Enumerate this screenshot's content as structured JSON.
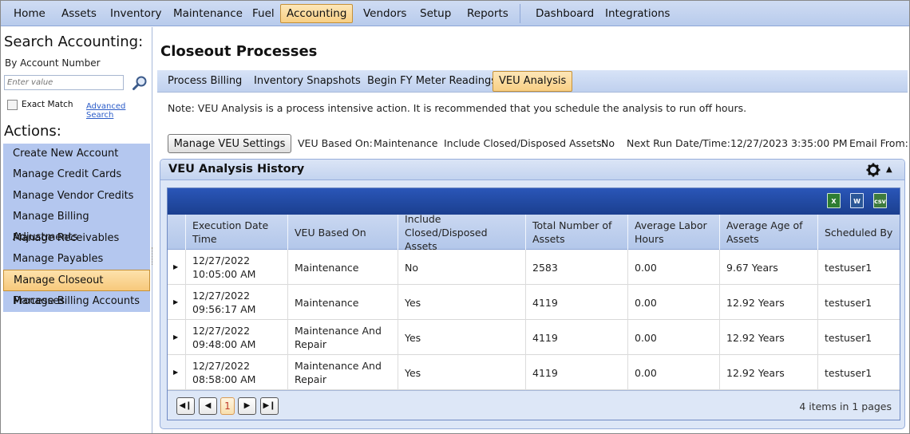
{
  "menu": {
    "items": [
      {
        "label": "Home"
      },
      {
        "label": "Assets"
      },
      {
        "label": "Inventory"
      },
      {
        "label": "Maintenance"
      },
      {
        "label": "Fuel"
      },
      {
        "label": "Accounting"
      },
      {
        "label": "Vendors"
      },
      {
        "label": "Setup"
      },
      {
        "label": "Reports"
      },
      {
        "label": "Dashboard"
      },
      {
        "label": "Integrations"
      }
    ],
    "active": "Accounting"
  },
  "sidebar": {
    "search_title": "Search Accounting:",
    "search_subtitle": "By Account Number",
    "search_placeholder": "Enter value",
    "exact_match_label": "Exact Match",
    "advanced_search_label": "Advanced Search",
    "actions_title": "Actions:",
    "actions": [
      {
        "label": "Create New Account"
      },
      {
        "label": "Manage Credit Cards"
      },
      {
        "label": "Manage Vendor Credits"
      },
      {
        "label": "Manage Billing Adjustments"
      },
      {
        "label": "Manage Receivables"
      },
      {
        "label": "Manage Payables"
      },
      {
        "label": "Manage Closeout Processes"
      },
      {
        "label": "Manage Billing Accounts"
      }
    ],
    "active_action": "Manage Closeout Processes"
  },
  "main": {
    "title": "Closeout Processes",
    "tabs": [
      {
        "label": "Process Billing"
      },
      {
        "label": "Inventory Snapshots"
      },
      {
        "label": "Begin FY Meter Readings"
      },
      {
        "label": "VEU Analysis"
      }
    ],
    "active_tab": "VEU Analysis",
    "note": "Note: VEU Analysis is a process intensive action. It is recommended that you schedule the analysis to run off hours.",
    "manage_button": "Manage VEU Settings",
    "veu_based_on_label": "VEU Based On:",
    "veu_based_on_value": "Maintenance",
    "include_closed_label": "Include Closed/Disposed Assets:",
    "include_closed_value": "No",
    "next_run_label": "Next Run Date/Time:",
    "next_run_value": "12/27/2023 3:35:00 PM",
    "email_from_label": "Email From:"
  },
  "history": {
    "title": "VEU Analysis History",
    "toolbar_icons": [
      "excel-export-icon",
      "word-export-icon",
      "csv-export-icon"
    ],
    "columns": [
      "Execution Date Time",
      "VEU Based On",
      "Include Closed/Disposed Assets",
      "Total Number of Assets",
      "Average Labor Hours",
      "Average Age of Assets",
      "Scheduled By"
    ],
    "rows": [
      [
        "12/27/2022 10:05:00 AM",
        "Maintenance",
        "No",
        "2583",
        "0.00",
        "9.67 Years",
        "testuser1"
      ],
      [
        "12/27/2022 09:56:17 AM",
        "Maintenance",
        "Yes",
        "4119",
        "0.00",
        "12.92 Years",
        "testuser1"
      ],
      [
        "12/27/2022 09:48:00 AM",
        "Maintenance And Repair",
        "Yes",
        "4119",
        "0.00",
        "12.92 Years",
        "testuser1"
      ],
      [
        "12/27/2022 08:58:00 AM",
        "Maintenance And Repair",
        "Yes",
        "4119",
        "0.00",
        "12.92 Years",
        "testuser1"
      ]
    ],
    "current_page": "1",
    "pager_info": "4 items in 1 pages"
  }
}
